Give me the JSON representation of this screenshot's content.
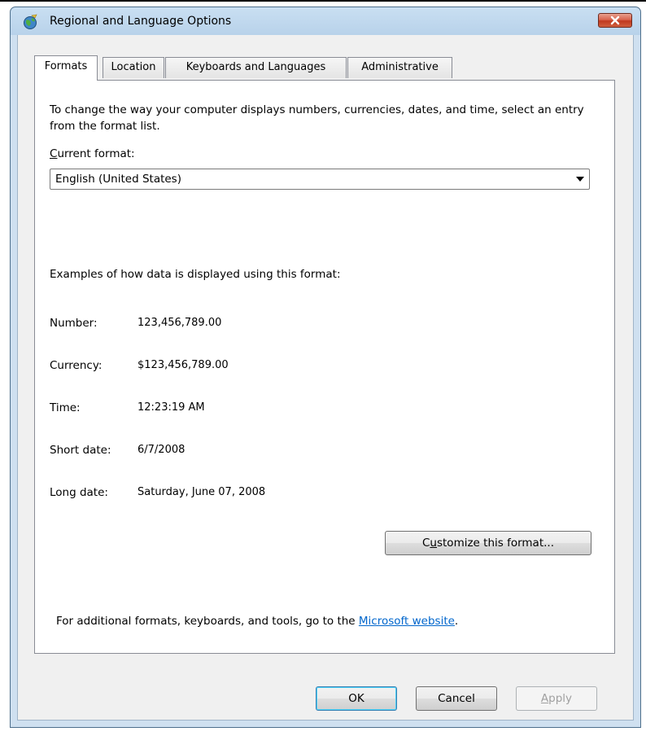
{
  "window": {
    "title": "Regional and Language Options"
  },
  "tabs": [
    {
      "label": "Formats",
      "active": true
    },
    {
      "label": "Location",
      "active": false
    },
    {
      "label": "Keyboards and Languages",
      "active": false
    },
    {
      "label": "Administrative",
      "active": false
    }
  ],
  "formats": {
    "intro": "To change the way your computer displays numbers, currencies, dates, and time, select an entry from the format list.",
    "current_format_label_first": "C",
    "current_format_label_rest": "urrent format:",
    "current_format_value": "English (United States)",
    "examples_heading": "Examples of how data is displayed using this format:",
    "examples": [
      {
        "label": "Number:",
        "value": "123,456,789.00"
      },
      {
        "label": "Currency:",
        "value": "$123,456,789.00"
      },
      {
        "label": "Time:",
        "value": "12:23:19 AM"
      },
      {
        "label": "Short date:",
        "value": "6/7/2008"
      },
      {
        "label": "Long date:",
        "value": "Saturday, June 07, 2008"
      }
    ],
    "customize_prefix": "C",
    "customize_mnemonic": "u",
    "customize_rest": "stomize this format...",
    "footer_prefix": "For additional formats, keyboards, and tools, go to the ",
    "footer_link": "Microsoft website",
    "footer_suffix": "."
  },
  "buttons": {
    "ok": "OK",
    "cancel": "Cancel",
    "apply_mnemonic": "A",
    "apply_rest": "pply"
  },
  "icons": {
    "app": "globe-icon",
    "close": "close-icon",
    "dropdown": "chevron-down-icon"
  },
  "colors": {
    "link": "#0066cc",
    "close_button": "#c0391f",
    "title_bar": "#b8d2ea"
  }
}
